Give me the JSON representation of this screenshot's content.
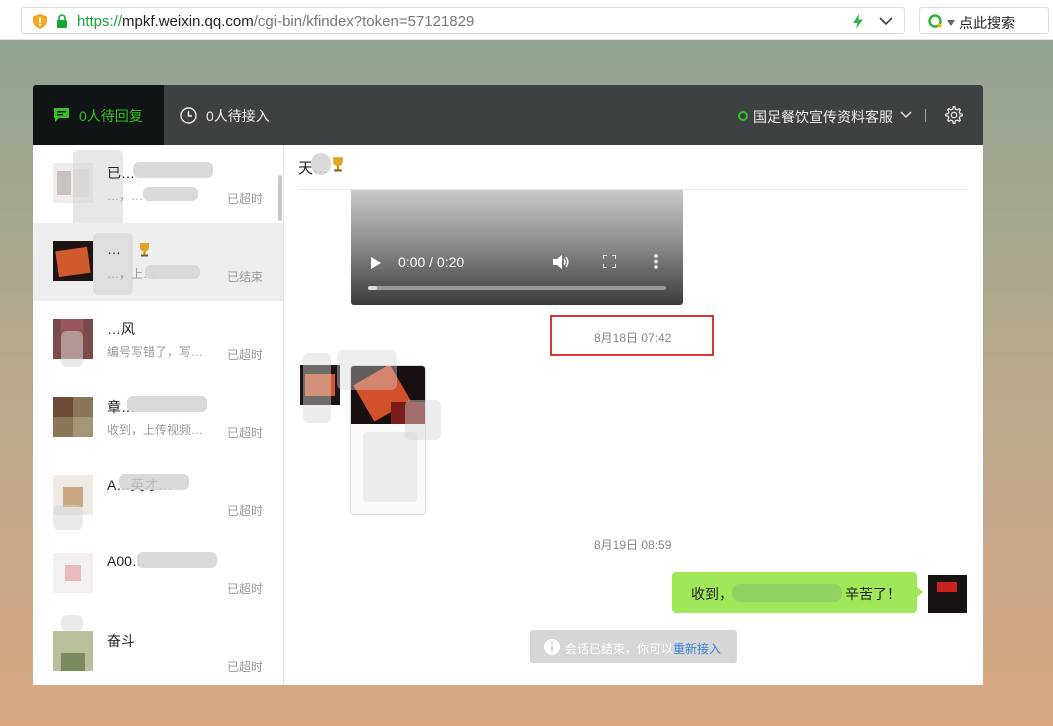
{
  "browser": {
    "url_scheme": "https://",
    "url_host": "mpkf.weixin.qq.com",
    "url_path": "/cgi-bin/kfindex?token=57121829",
    "search_label": "点此搜索"
  },
  "topbar": {
    "tab_reply_label": "0人待回复",
    "tab_waiting_label": "0人待接入",
    "account_name": "国足餐饮宣传资料客服",
    "online_color": "#2fc22b"
  },
  "sidebar": {
    "conversations": [
      {
        "name": "已…",
        "preview": "…，…",
        "status": "已超时"
      },
      {
        "name": "…",
        "preview": "…，上…",
        "status": "已结束"
      },
      {
        "name": "…风",
        "preview": "编号写错了，写…",
        "status": "已超时"
      },
      {
        "name": "章…",
        "preview": "收到，上传视频…",
        "status": "已超时"
      },
      {
        "name": "A…英才…",
        "preview": "",
        "status": "已超时"
      },
      {
        "name": "A00…",
        "preview": "",
        "status": "已超时"
      },
      {
        "name": "奋斗",
        "preview": "",
        "status": "已超时"
      }
    ]
  },
  "chat": {
    "contact_name": "天…",
    "video": {
      "time": "0:00 / 0:20",
      "progress": 0.03
    },
    "timestamp_1": "8月18日 07:42",
    "timestamp_2": "8月19日 08:59",
    "reply_prefix": "收到，",
    "reply_suffix": "辛苦了！",
    "notice_text": "会话已结束，你可以",
    "notice_link": "重新接入"
  }
}
